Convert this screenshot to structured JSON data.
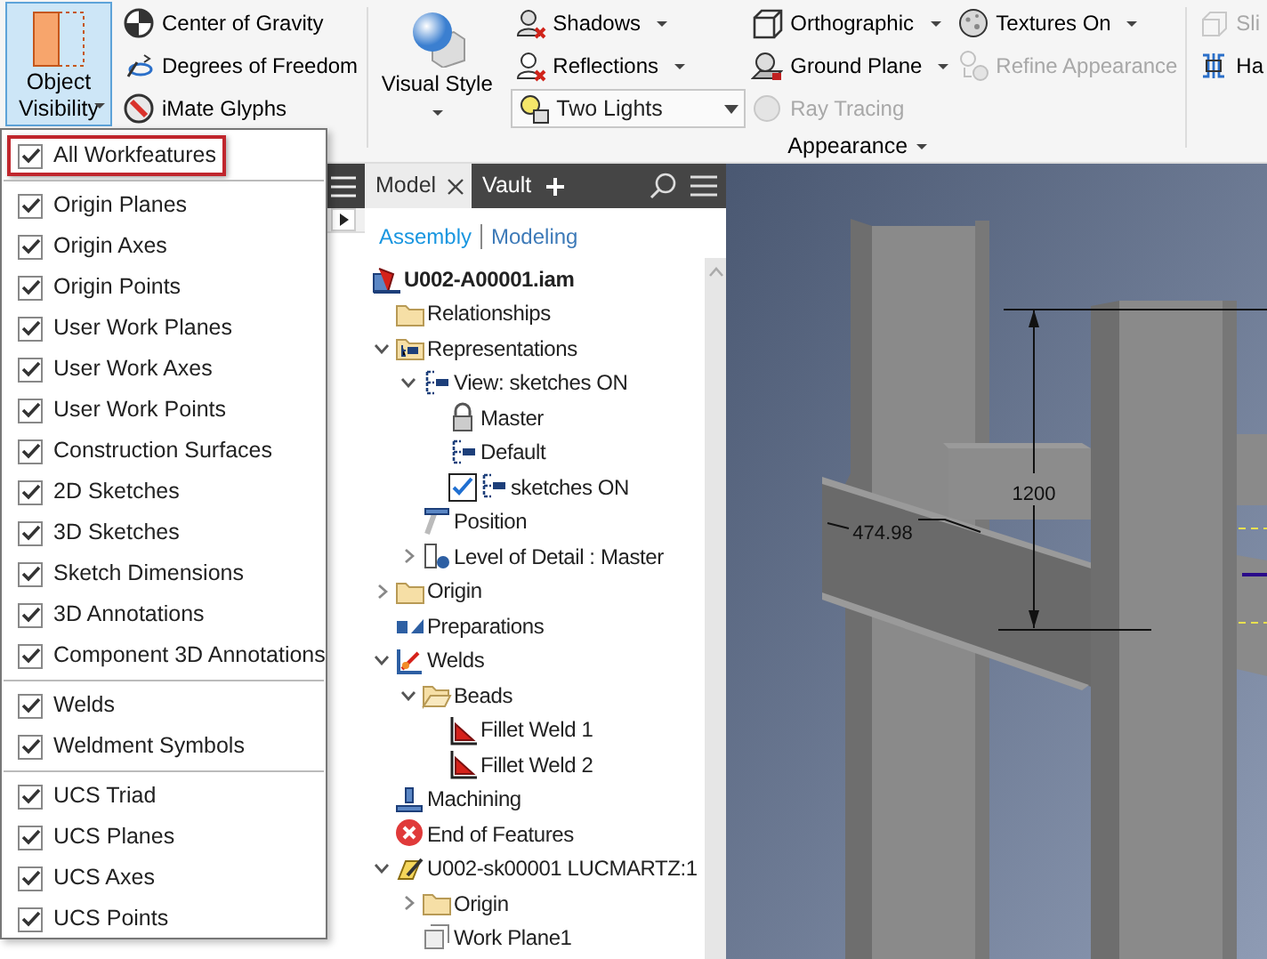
{
  "ribbon": {
    "object_visibility": {
      "label": "Object Visibility",
      "pressed": true
    },
    "display_tools": [
      {
        "label": "Center of Gravity"
      },
      {
        "label": "Degrees of Freedom"
      },
      {
        "label": "iMate Glyphs"
      }
    ],
    "visual_style": {
      "label": "Visual Style"
    },
    "appearance_tools": [
      [
        {
          "kind": "button",
          "label": "Shadows",
          "dropdown": true,
          "disabled": false
        },
        {
          "kind": "button",
          "label": "Reflections",
          "dropdown": true,
          "disabled": false
        },
        {
          "kind": "combo",
          "value": "Two Lights"
        }
      ],
      [
        {
          "kind": "button",
          "label": "Orthographic",
          "dropdown": true,
          "disabled": false
        },
        {
          "kind": "button",
          "label": "Ground Plane",
          "dropdown": true,
          "disabled": false
        },
        {
          "kind": "button",
          "label": "Ray Tracing",
          "dropdown": false,
          "disabled": true
        }
      ],
      [
        {
          "kind": "button",
          "label": "Textures On",
          "dropdown": true,
          "disabled": false
        },
        {
          "kind": "button",
          "label": "Refine Appearance",
          "dropdown": false,
          "disabled": true
        }
      ]
    ],
    "appearance_label": "Appearance",
    "next_panel_tools": [
      {
        "label": "Sli",
        "disabled": true
      },
      {
        "label": "Ha",
        "disabled": false
      }
    ]
  },
  "visibility_menu": {
    "groups": [
      [
        {
          "label": "All Workfeatures",
          "checked": true,
          "highlighted": true
        }
      ],
      [
        {
          "label": "Origin Planes",
          "checked": true,
          "highlighted": false
        },
        {
          "label": "Origin Axes",
          "checked": true,
          "highlighted": false
        },
        {
          "label": "Origin Points",
          "checked": true,
          "highlighted": false
        },
        {
          "label": "User Work Planes",
          "checked": true,
          "highlighted": false
        },
        {
          "label": "User Work Axes",
          "checked": true,
          "highlighted": false
        },
        {
          "label": "User Work Points",
          "checked": true,
          "highlighted": false
        },
        {
          "label": "Construction Surfaces",
          "checked": true,
          "highlighted": false
        },
        {
          "label": "2D Sketches",
          "checked": true,
          "highlighted": false
        },
        {
          "label": "3D Sketches",
          "checked": true,
          "highlighted": false
        },
        {
          "label": "Sketch Dimensions",
          "checked": true,
          "highlighted": false
        },
        {
          "label": "3D Annotations",
          "checked": true,
          "highlighted": false
        },
        {
          "label": "Component 3D Annotations",
          "checked": true,
          "highlighted": false
        }
      ],
      [
        {
          "label": "Welds",
          "checked": true,
          "highlighted": false
        },
        {
          "label": "Weldment Symbols",
          "checked": true,
          "highlighted": false
        }
      ],
      [
        {
          "label": "UCS Triad",
          "checked": true,
          "highlighted": false
        },
        {
          "label": "UCS Planes",
          "checked": true,
          "highlighted": false
        },
        {
          "label": "UCS Axes",
          "checked": true,
          "highlighted": false
        },
        {
          "label": "UCS Points",
          "checked": true,
          "highlighted": false
        }
      ]
    ]
  },
  "browser": {
    "tabs": [
      {
        "label": "Model",
        "selected": true
      },
      {
        "label": "Vault",
        "selected": false
      }
    ],
    "modes": [
      {
        "label": "Assembly",
        "selected": true
      },
      {
        "label": "Modeling",
        "selected": false
      }
    ],
    "tree": [
      {
        "label": "U002-A00001.iam",
        "kind": "assembly",
        "children": [
          {
            "label": "Relationships",
            "kind": "folder"
          },
          {
            "label": "Representations",
            "kind": "representations",
            "expanded": true,
            "children": [
              {
                "label": "View: sketches ON",
                "kind": "view",
                "expanded": true,
                "children": [
                  {
                    "label": "Master",
                    "kind": "lock"
                  },
                  {
                    "label": "Default",
                    "kind": "view"
                  },
                  {
                    "label": "sketches ON",
                    "kind": "view",
                    "checked": true
                  }
                ]
              },
              {
                "label": "Position",
                "kind": "position"
              },
              {
                "label": "Level of Detail : Master",
                "kind": "detail",
                "expanded": false
              }
            ]
          },
          {
            "label": "Origin",
            "kind": "folder",
            "expanded": false
          },
          {
            "label": "Preparations",
            "kind": "preparation"
          },
          {
            "label": "Welds",
            "kind": "weld",
            "expanded": true,
            "children": [
              {
                "label": "Beads",
                "kind": "folder-open",
                "expanded": true,
                "children": [
                  {
                    "label": "Fillet Weld 1",
                    "kind": "fillet"
                  },
                  {
                    "label": "Fillet Weld 2",
                    "kind": "fillet"
                  }
                ]
              }
            ]
          },
          {
            "label": "Machining",
            "kind": "machining"
          },
          {
            "label": "End of Features",
            "kind": "end"
          },
          {
            "label": "U002-sk00001 LUCMARTZ:1",
            "kind": "part",
            "expanded": true,
            "children": [
              {
                "label": "Origin",
                "kind": "folder",
                "expanded": false
              },
              {
                "label": "Work Plane1",
                "kind": "plane"
              }
            ]
          }
        ]
      }
    ]
  },
  "viewport": {
    "dimension_labels": [
      "1200",
      "474.98"
    ]
  }
}
